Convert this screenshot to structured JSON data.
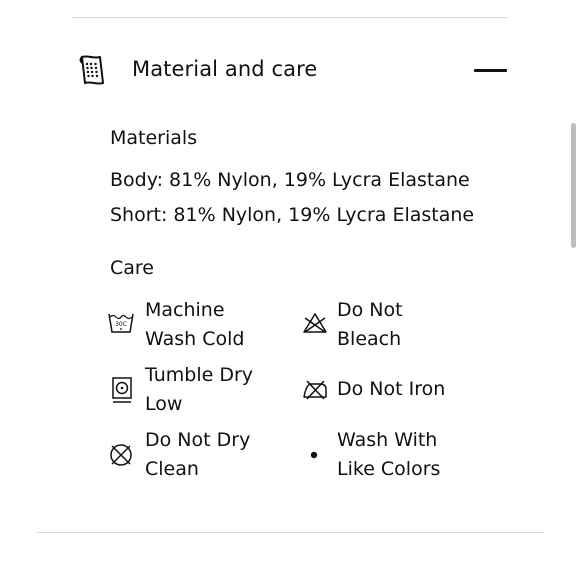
{
  "accordion": {
    "title": "Material and care",
    "header_icon": "care-label-icon",
    "toggle_icon": "minus-icon",
    "expanded": true
  },
  "materials": {
    "heading": "Materials",
    "lines": [
      "Body: 81% Nylon, 19% Lycra Elastane",
      "Short: 81% Nylon, 19% Lycra Elastane"
    ]
  },
  "care": {
    "heading": "Care",
    "items": [
      {
        "icon": "machine-wash-cold-icon",
        "icon_text": "30C",
        "line1": "Machine",
        "line2": "Wash Cold"
      },
      {
        "icon": "do-not-bleach-icon",
        "line1": "Do Not",
        "line2": "Bleach"
      },
      {
        "icon": "tumble-dry-low-icon",
        "line1": "Tumble Dry",
        "line2": "Low"
      },
      {
        "icon": "do-not-iron-icon",
        "line1": "Do Not Iron",
        "line2": ""
      },
      {
        "icon": "do-not-dry-clean-icon",
        "line1": "Do Not Dry",
        "line2": "Clean"
      },
      {
        "icon": "wash-with-like-colors-icon",
        "line1": "Wash With",
        "line2": "Like Colors"
      }
    ]
  }
}
